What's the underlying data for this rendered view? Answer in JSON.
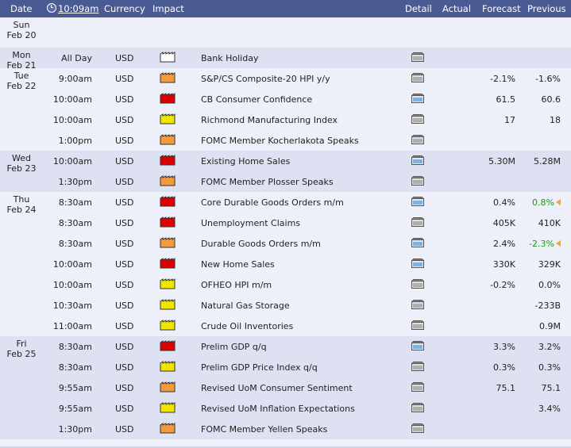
{
  "header": {
    "date": "Date",
    "time": "10:09am",
    "currency": "Currency",
    "impact": "Impact",
    "detail": "Detail",
    "actual": "Actual",
    "forecast": "Forecast",
    "previous": "Previous"
  },
  "colors": {
    "header_bg": "#4a5b94",
    "row_alt": "#dde1f1",
    "row_plain": "#eef0f9",
    "impact_high": "#dd0000",
    "impact_medium": "#f39a3c",
    "impact_low": "#f3e400",
    "impact_none": "#ffffff",
    "positive_value": "#189918"
  },
  "days": [
    {
      "day": "Sun",
      "date": "Feb 20",
      "events": []
    },
    {
      "day": "Mon",
      "date": "Feb 21",
      "events": [
        {
          "time": "All Day",
          "currency": "USD",
          "impact": "none",
          "name": "Bank Holiday",
          "detail": "gray",
          "actual": "",
          "forecast": "",
          "previous": "",
          "prev_flag": false
        }
      ]
    },
    {
      "day": "Tue",
      "date": "Feb 22",
      "events": [
        {
          "time": "9:00am",
          "currency": "USD",
          "impact": "medium",
          "name": "S&P/CS Composite-20 HPI y/y",
          "detail": "gray",
          "actual": "",
          "forecast": "-2.1%",
          "previous": "-1.6%",
          "prev_flag": false
        },
        {
          "time": "10:00am",
          "currency": "USD",
          "impact": "high",
          "name": "CB Consumer Confidence",
          "detail": "blue",
          "actual": "",
          "forecast": "61.5",
          "previous": "60.6",
          "prev_flag": false
        },
        {
          "time": "10:00am",
          "currency": "USD",
          "impact": "low",
          "name": "Richmond Manufacturing Index",
          "detail": "gray",
          "actual": "",
          "forecast": "17",
          "previous": "18",
          "prev_flag": false
        },
        {
          "time": "1:00pm",
          "currency": "USD",
          "impact": "medium",
          "name": "FOMC Member Kocherlakota Speaks",
          "detail": "gray",
          "actual": "",
          "forecast": "",
          "previous": "",
          "prev_flag": false
        }
      ]
    },
    {
      "day": "Wed",
      "date": "Feb 23",
      "events": [
        {
          "time": "10:00am",
          "currency": "USD",
          "impact": "high",
          "name": "Existing Home Sales",
          "detail": "blue",
          "actual": "",
          "forecast": "5.30M",
          "previous": "5.28M",
          "prev_flag": false
        },
        {
          "time": "1:30pm",
          "currency": "USD",
          "impact": "medium",
          "name": "FOMC Member Plosser Speaks",
          "detail": "gray",
          "actual": "",
          "forecast": "",
          "previous": "",
          "prev_flag": false
        }
      ]
    },
    {
      "day": "Thu",
      "date": "Feb 24",
      "events": [
        {
          "time": "8:30am",
          "currency": "USD",
          "impact": "high",
          "name": "Core Durable Goods Orders m/m",
          "detail": "blue",
          "actual": "",
          "forecast": "0.4%",
          "previous": "0.8%",
          "prev_flag": true
        },
        {
          "time": "8:30am",
          "currency": "USD",
          "impact": "high",
          "name": "Unemployment Claims",
          "detail": "gray",
          "actual": "",
          "forecast": "405K",
          "previous": "410K",
          "prev_flag": false
        },
        {
          "time": "8:30am",
          "currency": "USD",
          "impact": "medium",
          "name": "Durable Goods Orders m/m",
          "detail": "blue",
          "actual": "",
          "forecast": "2.4%",
          "previous": "-2.3%",
          "prev_flag": true
        },
        {
          "time": "10:00am",
          "currency": "USD",
          "impact": "high",
          "name": "New Home Sales",
          "detail": "blue",
          "actual": "",
          "forecast": "330K",
          "previous": "329K",
          "prev_flag": false
        },
        {
          "time": "10:00am",
          "currency": "USD",
          "impact": "low",
          "name": "OFHEO HPI m/m",
          "detail": "gray",
          "actual": "",
          "forecast": "-0.2%",
          "previous": "0.0%",
          "prev_flag": false
        },
        {
          "time": "10:30am",
          "currency": "USD",
          "impact": "low",
          "name": "Natural Gas Storage",
          "detail": "gray",
          "actual": "",
          "forecast": "",
          "previous": "-233B",
          "prev_flag": false
        },
        {
          "time": "11:00am",
          "currency": "USD",
          "impact": "low",
          "name": "Crude Oil Inventories",
          "detail": "gray",
          "actual": "",
          "forecast": "",
          "previous": "0.9M",
          "prev_flag": false
        }
      ]
    },
    {
      "day": "Fri",
      "date": "Feb 25",
      "events": [
        {
          "time": "8:30am",
          "currency": "USD",
          "impact": "high",
          "name": "Prelim GDP q/q",
          "detail": "blue",
          "actual": "",
          "forecast": "3.3%",
          "previous": "3.2%",
          "prev_flag": false
        },
        {
          "time": "8:30am",
          "currency": "USD",
          "impact": "low",
          "name": "Prelim GDP Price Index q/q",
          "detail": "gray",
          "actual": "",
          "forecast": "0.3%",
          "previous": "0.3%",
          "prev_flag": false
        },
        {
          "time": "9:55am",
          "currency": "USD",
          "impact": "medium",
          "name": "Revised UoM Consumer Sentiment",
          "detail": "gray",
          "actual": "",
          "forecast": "75.1",
          "previous": "75.1",
          "prev_flag": false
        },
        {
          "time": "9:55am",
          "currency": "USD",
          "impact": "low",
          "name": "Revised UoM Inflation Expectations",
          "detail": "gray",
          "actual": "",
          "forecast": "",
          "previous": "3.4%",
          "prev_flag": false
        },
        {
          "time": "1:30pm",
          "currency": "USD",
          "impact": "medium",
          "name": "FOMC Member Yellen Speaks",
          "detail": "gray",
          "actual": "",
          "forecast": "",
          "previous": "",
          "prev_flag": false
        }
      ]
    }
  ]
}
